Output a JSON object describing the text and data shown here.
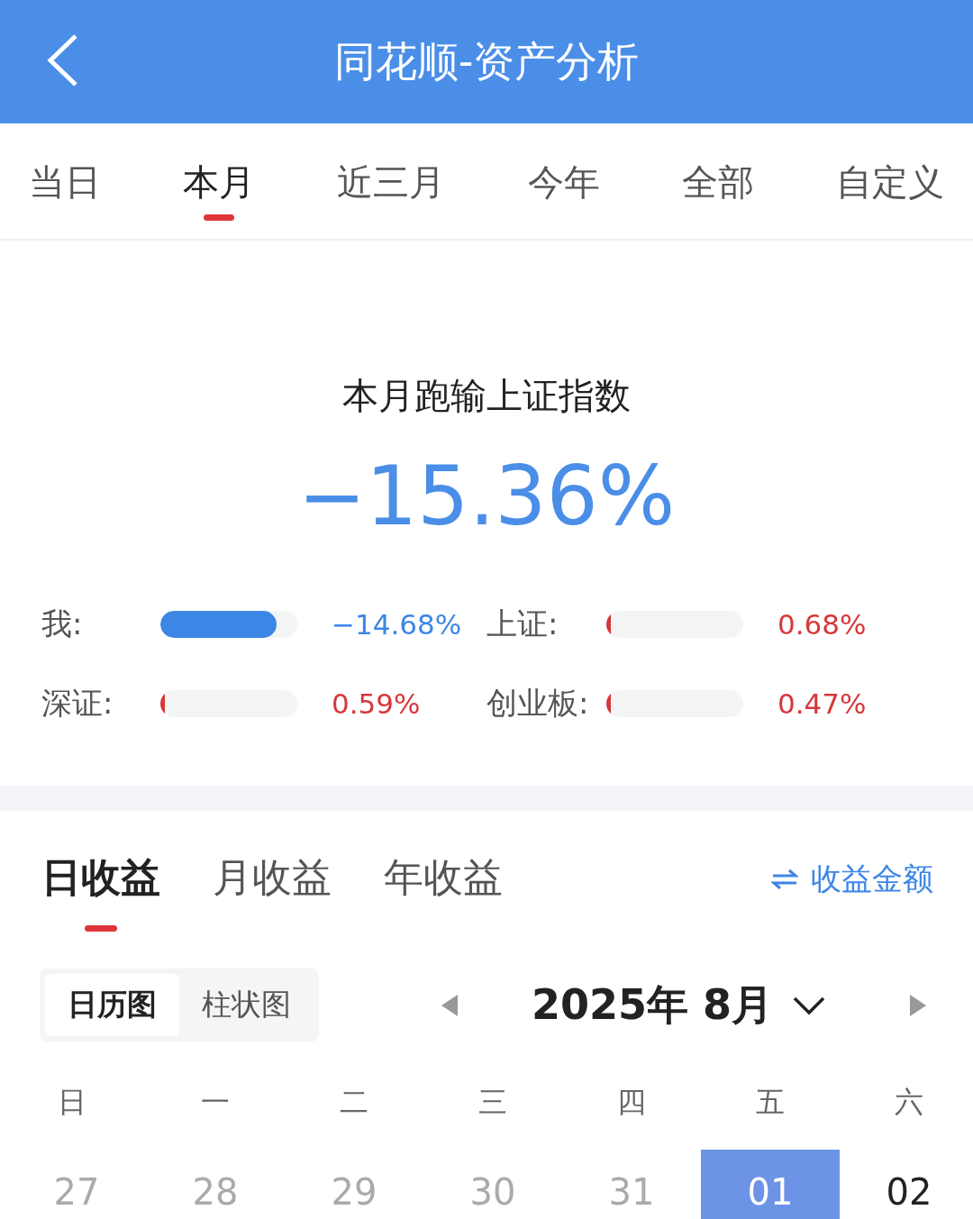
{
  "header": {
    "title": "同花顺-资产分析"
  },
  "period_tabs": [
    {
      "label": "当日",
      "selected": false
    },
    {
      "label": "本月",
      "selected": true
    },
    {
      "label": "近三月",
      "selected": false
    },
    {
      "label": "今年",
      "selected": false
    },
    {
      "label": "全部",
      "selected": false
    },
    {
      "label": "自定义",
      "selected": false
    }
  ],
  "summary": {
    "title": "本月跑输上证指数",
    "value": "−15.36%"
  },
  "comparisons": [
    {
      "label": "我:",
      "level": 0.85,
      "color": "#3d86e6",
      "reading": "−14.68%"
    },
    {
      "label": "上证:",
      "level": 0.03,
      "color": "#d6373a",
      "reading": "0.68%"
    },
    {
      "label": "深证:",
      "level": 0.03,
      "color": "#d6373a",
      "reading": "0.59%"
    },
    {
      "label": "创业板:",
      "level": 0.03,
      "color": "#d6373a",
      "reading": "0.47%"
    }
  ],
  "earnings_tabs": [
    {
      "label": "日收益",
      "selected": true
    },
    {
      "label": "月收益",
      "selected": false
    },
    {
      "label": "年收益",
      "selected": false
    }
  ],
  "switch_link": "收益金额",
  "view_toggle": [
    {
      "label": "日历图",
      "selected": true
    },
    {
      "label": "柱状图",
      "selected": false
    }
  ],
  "month": "2025年 8月",
  "weekdays": [
    "日",
    "一",
    "二",
    "三",
    "四",
    "五",
    "六"
  ],
  "days": [
    {
      "label": "27",
      "kind": "other_month",
      "selected": false
    },
    {
      "label": "28",
      "kind": "other_month",
      "selected": false
    },
    {
      "label": "29",
      "kind": "other_month",
      "selected": false
    },
    {
      "label": "30",
      "kind": "other_month",
      "selected": false
    },
    {
      "label": "31",
      "kind": "other_month",
      "selected": false
    },
    {
      "label": "01",
      "kind": "current",
      "selected": true
    },
    {
      "label": "02",
      "kind": "current",
      "selected": false
    }
  ]
}
